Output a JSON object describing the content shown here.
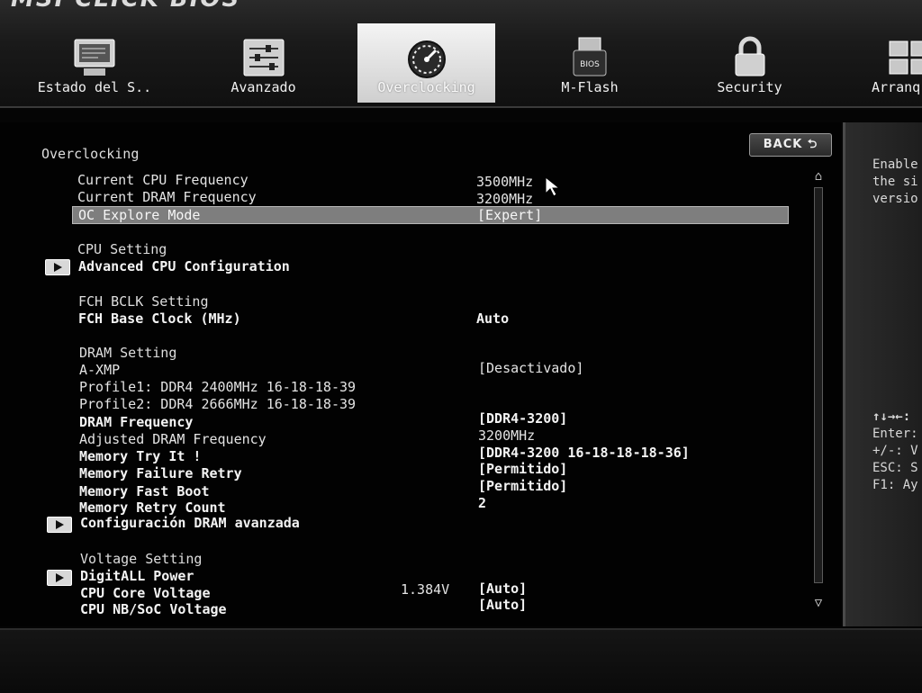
{
  "brand": "MSI CLICK BIOS",
  "tabs": [
    {
      "label": "Estado del S..",
      "icon": "monitor-icon"
    },
    {
      "label": "Avanzado",
      "icon": "sliders-icon"
    },
    {
      "label": "Overclocking",
      "icon": "speedometer-icon"
    },
    {
      "label": "M-Flash",
      "icon": "usb-flash-icon"
    },
    {
      "label": "Security",
      "icon": "lock-icon"
    },
    {
      "label": "Arranq",
      "icon": "boot-icon"
    }
  ],
  "active_tab": "Overclocking",
  "section_title": "Overclocking",
  "back_label": "BACK ⮌",
  "cpu_freq": {
    "label": "Current CPU Frequency",
    "value": "3500MHz"
  },
  "dram_freq": {
    "label": "Current DRAM Frequency",
    "value": "3200MHz"
  },
  "oc_mode": {
    "label": "OC Explore Mode",
    "value": "[Expert]"
  },
  "cpu_setting": {
    "header": "CPU Setting",
    "submenu": "Advanced CPU Configuration"
  },
  "fch": {
    "header": "FCH BCLK Setting",
    "label": "FCH Base Clock (MHz)",
    "value": "Auto"
  },
  "dram": {
    "header": "DRAM Setting",
    "axmp": {
      "label": "A-XMP",
      "value": "[Desactivado]"
    },
    "profile1": "Profile1: DDR4 2400MHz 16-18-18-39",
    "profile2": "Profile2: DDR4 2666MHz 16-18-18-39",
    "frequency": {
      "label": "DRAM Frequency",
      "value": "[DDR4-3200]"
    },
    "adjusted": {
      "label": "Adjusted DRAM Frequency",
      "value": "3200MHz"
    },
    "try_it": {
      "label": "Memory Try It !",
      "value": "[DDR4-3200 16-18-18-18-36]"
    },
    "failure_retry": {
      "label": "Memory Failure Retry",
      "value": "[Permitido]"
    },
    "fast_boot": {
      "label": "Memory Fast Boot",
      "value": "[Permitido]"
    },
    "retry_count": {
      "label": "Memory Retry Count",
      "value": "2"
    },
    "advanced": "Configuración DRAM avanzada"
  },
  "voltage": {
    "header": "Voltage Setting",
    "digitall": "DigitALL Power",
    "core": {
      "label": "CPU Core Voltage",
      "reading": "1.384V",
      "value": "[Auto]"
    },
    "nb_soc": {
      "label": "CPU NB/SoC Voltage",
      "value": "[Auto]"
    }
  },
  "help": {
    "lines": [
      "Enable",
      "the si",
      "versio"
    ],
    "keys": [
      "↑↓→←:",
      "Enter:",
      "+/-: V",
      "ESC: S",
      "F1: Ay"
    ]
  },
  "colors": {
    "background": "#050505",
    "selection": "#7e7e7e",
    "active_tab": "#e8e8e8"
  }
}
